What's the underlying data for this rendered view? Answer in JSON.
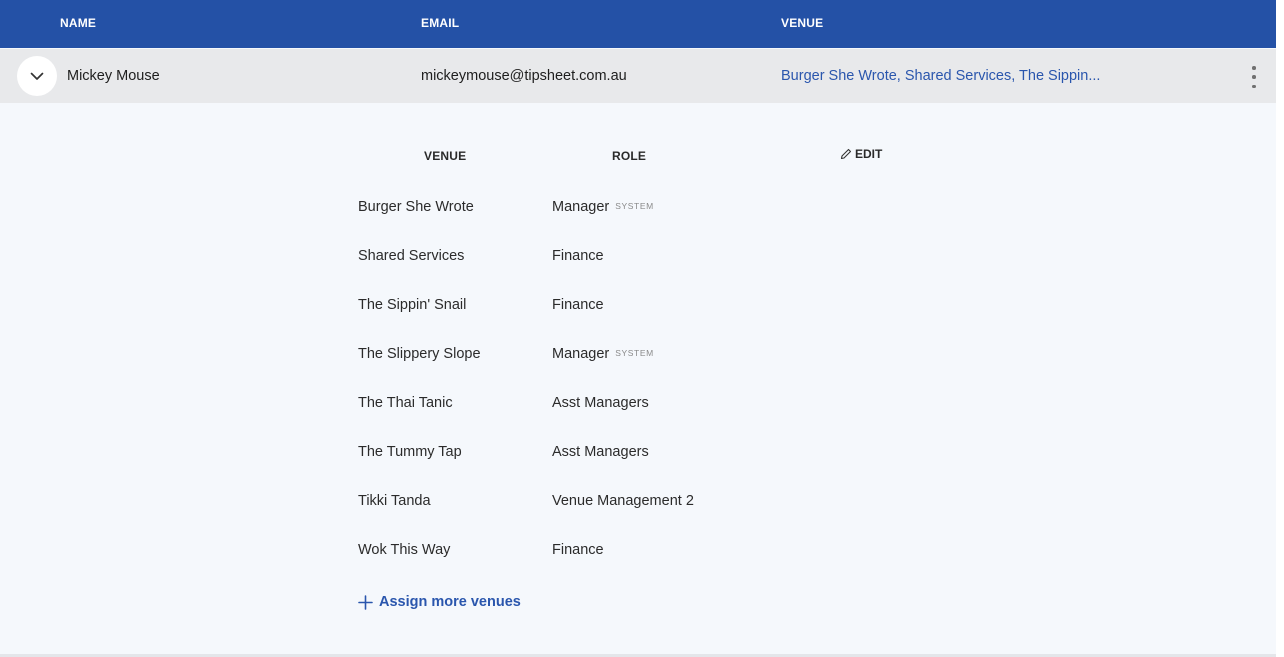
{
  "header": {
    "name_label": "NAME",
    "email_label": "EMAIL",
    "venue_label": "VENUE"
  },
  "user": {
    "name": "Mickey Mouse",
    "email": "mickeymouse@tipsheet.com.au",
    "venues_summary": "Burger She Wrote, Shared Services, The Sippin..."
  },
  "detail": {
    "venue_header": "VENUE",
    "role_header": "ROLE",
    "edit_label": "EDIT",
    "assignments": [
      {
        "venue": "Burger She Wrote",
        "role": "Manager",
        "tag": "SYSTEM"
      },
      {
        "venue": "Shared Services",
        "role": "Finance",
        "tag": ""
      },
      {
        "venue": "The Sippin' Snail",
        "role": "Finance",
        "tag": ""
      },
      {
        "venue": "The Slippery Slope",
        "role": "Manager",
        "tag": "SYSTEM"
      },
      {
        "venue": "The Thai Tanic",
        "role": "Asst Managers",
        "tag": ""
      },
      {
        "venue": "The Tummy Tap",
        "role": "Asst Managers",
        "tag": ""
      },
      {
        "venue": "Tikki Tanda",
        "role": "Venue Management 2",
        "tag": ""
      },
      {
        "venue": "Wok This Way",
        "role": "Finance",
        "tag": ""
      }
    ],
    "assign_more_label": "Assign more venues"
  },
  "icons": {
    "expand": "chevron-down-icon",
    "menu": "more-vertical-icon",
    "edit": "pencil-icon",
    "add": "plus-icon"
  },
  "colors": {
    "header_bg": "#2451a6",
    "link": "#2a56ad",
    "row_bg": "#e8e9eb",
    "detail_bg": "#f5f8fc"
  }
}
